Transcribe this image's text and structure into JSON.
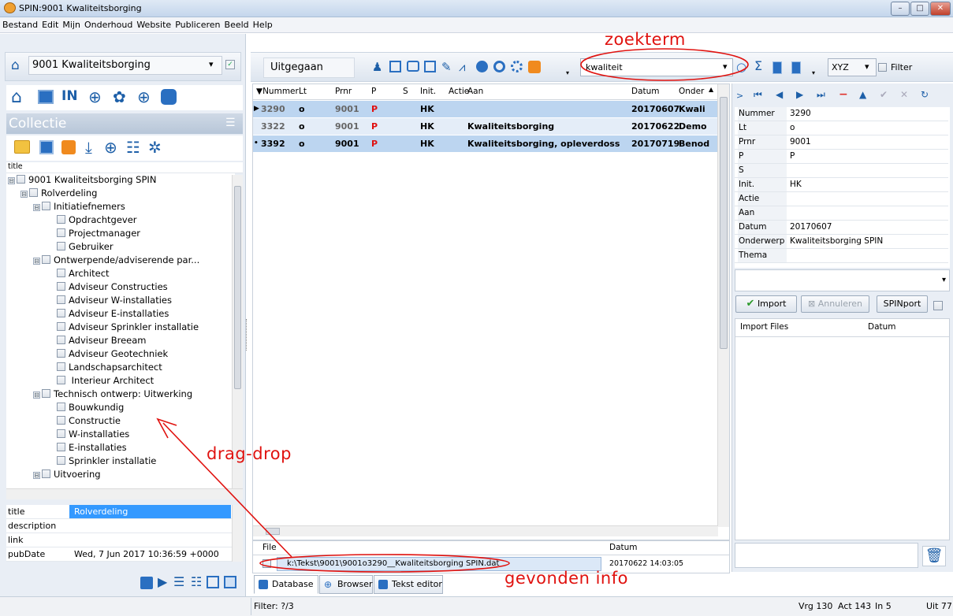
{
  "window": {
    "title": "SPIN:9001 Kwaliteitsborging",
    "min": "–",
    "max": "□",
    "close": "✕"
  },
  "menu": [
    "Bestand",
    "Edit",
    "Mijn",
    "Onderhoud",
    "Website",
    "Publiceren",
    "Beeld",
    "Help"
  ],
  "left": {
    "project_combo": "9001 Kwaliteitsborging",
    "collectie_label": "Collectie",
    "tree_header": "title",
    "tree": [
      {
        "label": "9001 Kwaliteitsborging SPIN",
        "level": 0,
        "expander": "⊟"
      },
      {
        "label": "Rolverdeling",
        "level": 1,
        "expander": "⊟",
        "selected": true
      },
      {
        "label": "Initiatiefnemers",
        "level": 2,
        "expander": "⊟"
      },
      {
        "label": "Opdrachtgever",
        "level": 3
      },
      {
        "label": "Projectmanager",
        "level": 3
      },
      {
        "label": "Gebruiker",
        "level": 3
      },
      {
        "label": "Ontwerpende/adviserende par...",
        "level": 2,
        "expander": "⊟"
      },
      {
        "label": "Architect",
        "level": 3
      },
      {
        "label": "Adviseur Constructies",
        "level": 3
      },
      {
        "label": "Adviseur W-installaties",
        "level": 3
      },
      {
        "label": "Adviseur E-installaties",
        "level": 3
      },
      {
        "label": "Adviseur Sprinkler installatie",
        "level": 3
      },
      {
        "label": "Adviseur Breeam",
        "level": 3
      },
      {
        "label": "Adviseur Geotechniek",
        "level": 3
      },
      {
        "label": "Landschapsarchitect",
        "level": 3
      },
      {
        "label": " Interieur Architect",
        "level": 3
      },
      {
        "label": "Technisch ontwerp: Uitwerking",
        "level": 2,
        "expander": "⊟"
      },
      {
        "label": "Bouwkundig",
        "level": 3
      },
      {
        "label": "Constructie",
        "level": 3
      },
      {
        "label": "W-installaties",
        "level": 3
      },
      {
        "label": "E-installaties",
        "level": 3
      },
      {
        "label": "Sprinkler installatie",
        "level": 3
      },
      {
        "label": "Uitvoering",
        "level": 2,
        "expander": "⊟"
      }
    ],
    "props": [
      {
        "key": "title",
        "value": "Rolverdeling"
      },
      {
        "key": "description",
        "value": ""
      },
      {
        "key": "link",
        "value": ""
      },
      {
        "key": "pubDate",
        "value": "Wed, 7 Jun 2017 10:36:59 +0000"
      }
    ]
  },
  "center": {
    "status_label": "Uitgegaan",
    "search_value": "kwaliteit",
    "xyz_combo": "XYZ",
    "filter_label": "Filter",
    "columns": [
      "▼Nummer",
      "Lt",
      "Prnr",
      "P",
      "S",
      "Init.",
      "Actie",
      "Aan",
      "Datum",
      "Onder"
    ],
    "rows": [
      {
        "nummer": "3290",
        "lt": "o",
        "prnr": "9001",
        "p": "P",
        "s": "",
        "init": "HK",
        "actie": "",
        "aan": "",
        "datum": "20170607",
        "onder": "Kwali",
        "marker": "▶"
      },
      {
        "nummer": "3322",
        "lt": "o",
        "prnr": "9001",
        "p": "P",
        "s": "",
        "init": "HK",
        "actie": "",
        "aan": "Kwaliteitsborging",
        "datum": "20170622",
        "onder": "Demo",
        "marker": ""
      },
      {
        "nummer": "3392",
        "lt": "o",
        "prnr": "9001",
        "p": "P",
        "s": "",
        "init": "HK",
        "actie": "",
        "aan": "Kwaliteitsborging, opleverdoss",
        "datum": "20170719",
        "onder": "Benod",
        "marker": "•"
      }
    ],
    "file_header": "File",
    "datum_header": "Datum",
    "file_row": {
      "path": "k:\\Tekst\\9001\\9001o3290__Kwaliteitsborging SPIN.dat",
      "datum": "20170622 14:03:05"
    },
    "tabs": [
      "Database",
      "Browser",
      "Tekst editor"
    ],
    "filter_status": "Filter: ?/3"
  },
  "right": {
    "record_props": [
      {
        "key": "Nummer",
        "value": "3290"
      },
      {
        "key": "Lt",
        "value": "o"
      },
      {
        "key": "Prnr",
        "value": "9001"
      },
      {
        "key": "P",
        "value": "P"
      },
      {
        "key": "S",
        "value": ""
      },
      {
        "key": "Init.",
        "value": "HK"
      },
      {
        "key": "Actie",
        "value": ""
      },
      {
        "key": "Aan",
        "value": ""
      },
      {
        "key": "Datum",
        "value": "20170607"
      },
      {
        "key": "Onderwerp",
        "value": "Kwaliteitsborging SPIN"
      },
      {
        "key": "Thema",
        "value": ""
      }
    ],
    "import_label": "Import",
    "annuleren_label": "Annuleren",
    "spinport_label": "SPINport",
    "import_files_header": "Import Files",
    "import_datum_header": "Datum"
  },
  "statusbar": {
    "vrg": "Vrg 130",
    "act": "Act 143",
    "in": "In 5",
    "uit": "Uit 77"
  },
  "annotations": {
    "zoekterm": "zoekterm",
    "dragdrop": "drag-drop",
    "gevonden": "gevonden info"
  },
  "colors": {
    "selection": "#bcd5f0",
    "header_bg": "#e9eef5",
    "annotation": "#e0120f",
    "accent_blue": "#2a6fc1"
  }
}
